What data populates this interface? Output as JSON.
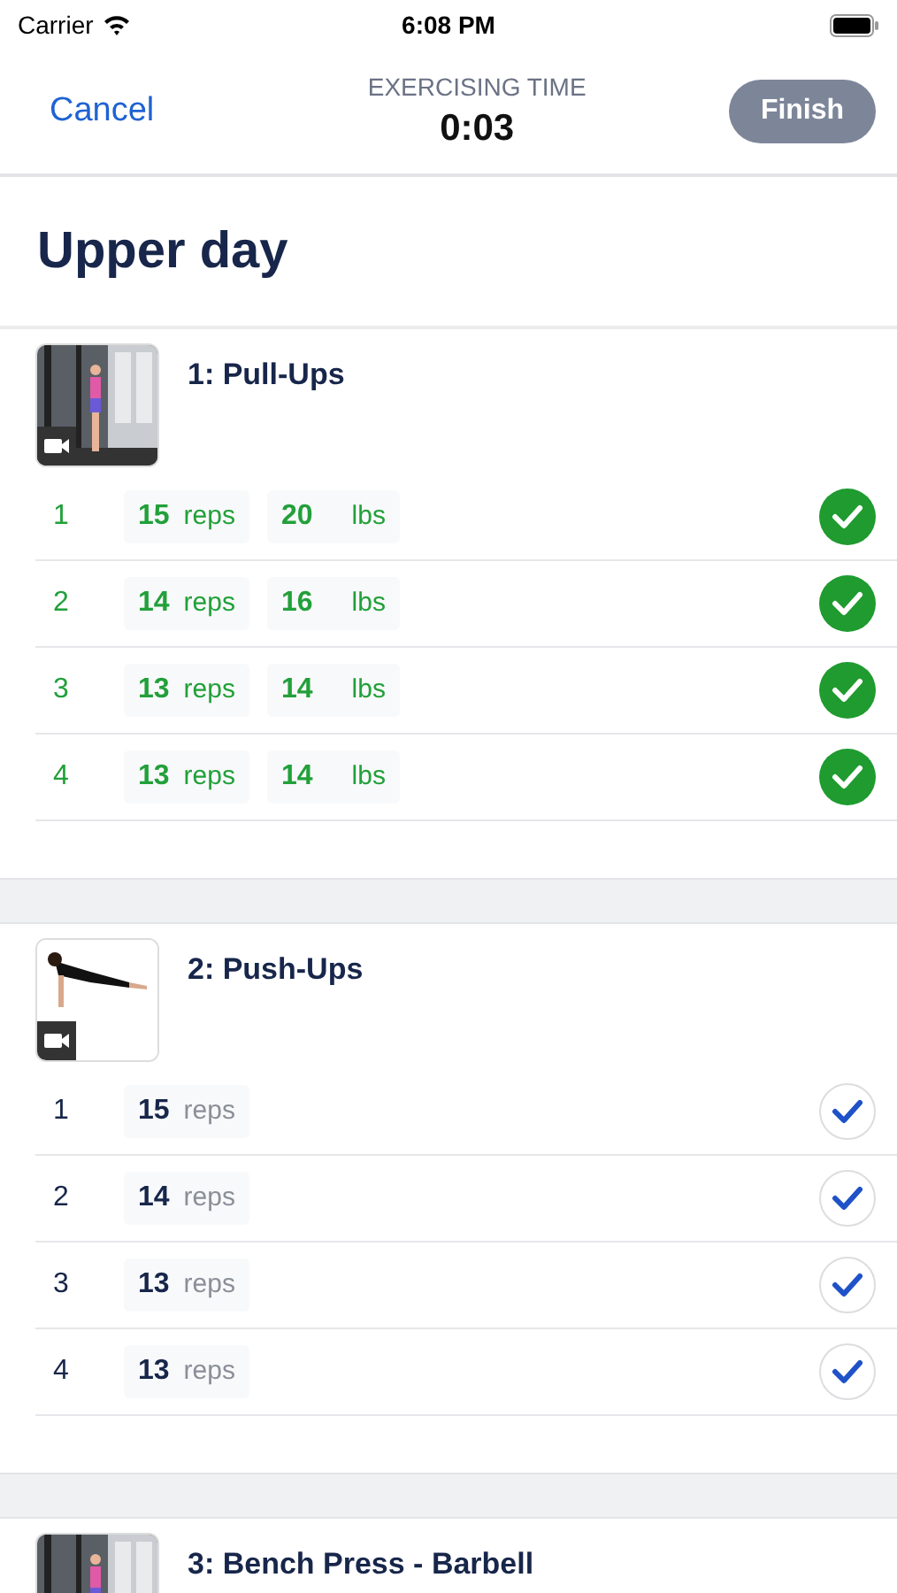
{
  "status_bar": {
    "carrier": "Carrier",
    "time": "6:08 PM"
  },
  "nav": {
    "cancel": "Cancel",
    "timer_label": "EXERCISING TIME",
    "timer": "0:03",
    "finish": "Finish"
  },
  "workout_title": "Upper day",
  "exercises": [
    {
      "title": "1: Pull-Ups",
      "has_video": true,
      "sets": [
        {
          "number": "1",
          "reps": "15",
          "reps_unit": "reps",
          "weight": "20",
          "weight_unit": "lbs",
          "completed": true
        },
        {
          "number": "2",
          "reps": "14",
          "reps_unit": "reps",
          "weight": "16",
          "weight_unit": "lbs",
          "completed": true
        },
        {
          "number": "3",
          "reps": "13",
          "reps_unit": "reps",
          "weight": "14",
          "weight_unit": "lbs",
          "completed": true
        },
        {
          "number": "4",
          "reps": "13",
          "reps_unit": "reps",
          "weight": "14",
          "weight_unit": "lbs",
          "completed": true
        }
      ]
    },
    {
      "title": "2: Push-Ups",
      "has_video": true,
      "sets": [
        {
          "number": "1",
          "reps": "15",
          "reps_unit": "reps",
          "completed": false
        },
        {
          "number": "2",
          "reps": "14",
          "reps_unit": "reps",
          "completed": false
        },
        {
          "number": "3",
          "reps": "13",
          "reps_unit": "reps",
          "completed": false
        },
        {
          "number": "4",
          "reps": "13",
          "reps_unit": "reps",
          "completed": false
        }
      ]
    },
    {
      "title": "3: Bench Press - Barbell"
    }
  ]
}
